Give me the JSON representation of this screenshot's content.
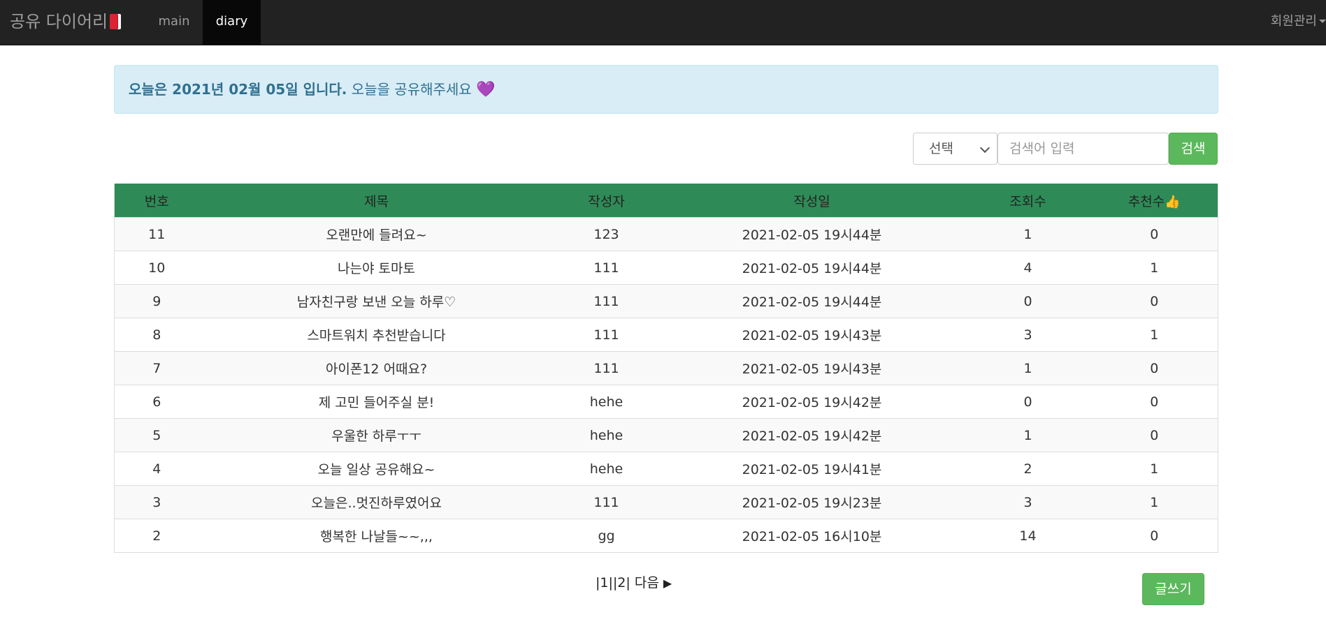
{
  "navbar": {
    "brand": "공유 다이어리",
    "brand_icon": "book-icon",
    "items": [
      {
        "label": "main"
      },
      {
        "label": "diary",
        "active": true
      }
    ],
    "member_menu": "회원관리"
  },
  "alert": {
    "date_text": "오늘은 2021년 02월 05일 입니다.",
    "message": "오늘을 공유해주세요",
    "heart": "💜"
  },
  "search": {
    "select_value": "선택",
    "input_placeholder": "검색어 입력",
    "button_label": "검색"
  },
  "table": {
    "headers": [
      "번호",
      "제목",
      "작성자",
      "작성일",
      "조회수",
      "추천수"
    ],
    "thumb": "👍",
    "rows": [
      [
        "11",
        "오랜만에 들려요~",
        "123",
        "2021-02-05 19시44분",
        "1",
        "0"
      ],
      [
        "10",
        "나는야 토마토",
        "111",
        "2021-02-05 19시44분",
        "4",
        "1"
      ],
      [
        "9",
        "남자친구랑 보낸 오늘 하루♡",
        "111",
        "2021-02-05 19시44분",
        "0",
        "0"
      ],
      [
        "8",
        "스마트워치 추천받습니다",
        "111",
        "2021-02-05 19시43분",
        "3",
        "1"
      ],
      [
        "7",
        "아이폰12 어때요?",
        "111",
        "2021-02-05 19시43분",
        "1",
        "0"
      ],
      [
        "6",
        "제 고민 들어주실 분!",
        "hehe",
        "2021-02-05 19시42분",
        "0",
        "0"
      ],
      [
        "5",
        "우울한 하루ㅜㅜ",
        "hehe",
        "2021-02-05 19시42분",
        "1",
        "0"
      ],
      [
        "4",
        "오늘 일상 공유해요~",
        "hehe",
        "2021-02-05 19시41분",
        "2",
        "1"
      ],
      [
        "3",
        "오늘은..멋진하루였어요",
        "111",
        "2021-02-05 19시23분",
        "3",
        "1"
      ],
      [
        "2",
        "행복한 나날들~~,,,",
        "gg",
        "2021-02-05 16시10분",
        "14",
        "0"
      ]
    ]
  },
  "pagination": {
    "pages": [
      "|1|",
      "|2|"
    ],
    "next": "다음",
    "next_arrow": "▶"
  },
  "write_button": "글쓰기"
}
